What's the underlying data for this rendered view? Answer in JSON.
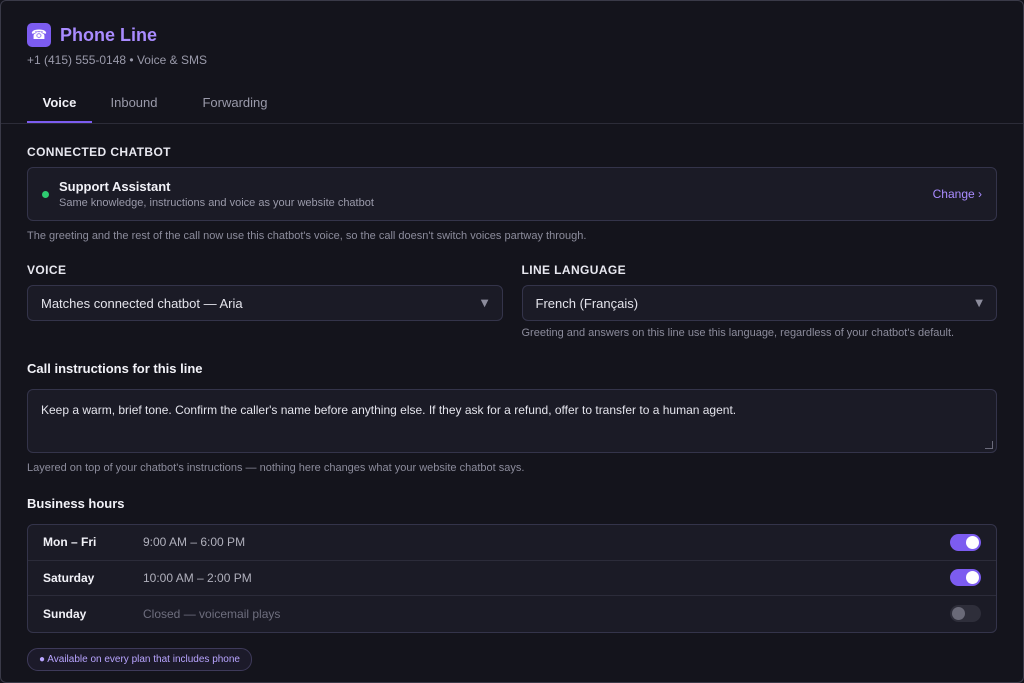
{
  "header": {
    "icon": "phone-icon",
    "icon_glyph": "☎",
    "title": "Phone Line",
    "subtitle": "+1 (415) 555-0148 • Voice & SMS"
  },
  "tabs": [
    {
      "label": "Voice",
      "active": true
    },
    {
      "label": "Inbound",
      "active": false
    },
    {
      "label": "Forwarding",
      "active": false
    }
  ],
  "connected_chatbot": {
    "section_label": "CONNECTED CHATBOT",
    "status_color": "#2ecc71",
    "name": "Support Assistant",
    "description": "Same knowledge, instructions and voice as your website chatbot",
    "change_label": "Change ›",
    "hint": "The greeting and the rest of the call now use this chatbot's voice, so the call doesn't switch voices partway through."
  },
  "voice": {
    "label": "VOICE",
    "value": "Matches connected chatbot — Aria"
  },
  "line_language": {
    "label": "LINE LANGUAGE",
    "value": "French (Français)",
    "hint": "Greeting and answers on this line use this language, regardless of your chatbot's default."
  },
  "call_instructions": {
    "heading": "Call instructions for this line",
    "value": "Keep a warm, brief tone. Confirm the caller's name before anything else. If they ask for a refund, offer to transfer to a human agent.",
    "hint": "Layered on top of your chatbot's instructions — nothing here changes what your website chatbot says."
  },
  "business_hours": {
    "heading": "Business hours",
    "rows": [
      {
        "day": "Mon – Fri",
        "hours": "9:00 AM – 6:00 PM",
        "enabled": true
      },
      {
        "day": "Saturday",
        "hours": "10:00 AM – 2:00 PM",
        "enabled": true
      },
      {
        "day": "Sunday",
        "hours": "Closed — voicemail plays",
        "enabled": false
      }
    ]
  },
  "availability_pill": "● Available on every plan that includes phone",
  "colors": {
    "accent": "#7c5cf0",
    "title": "#a98bff",
    "background": "#14141c"
  }
}
